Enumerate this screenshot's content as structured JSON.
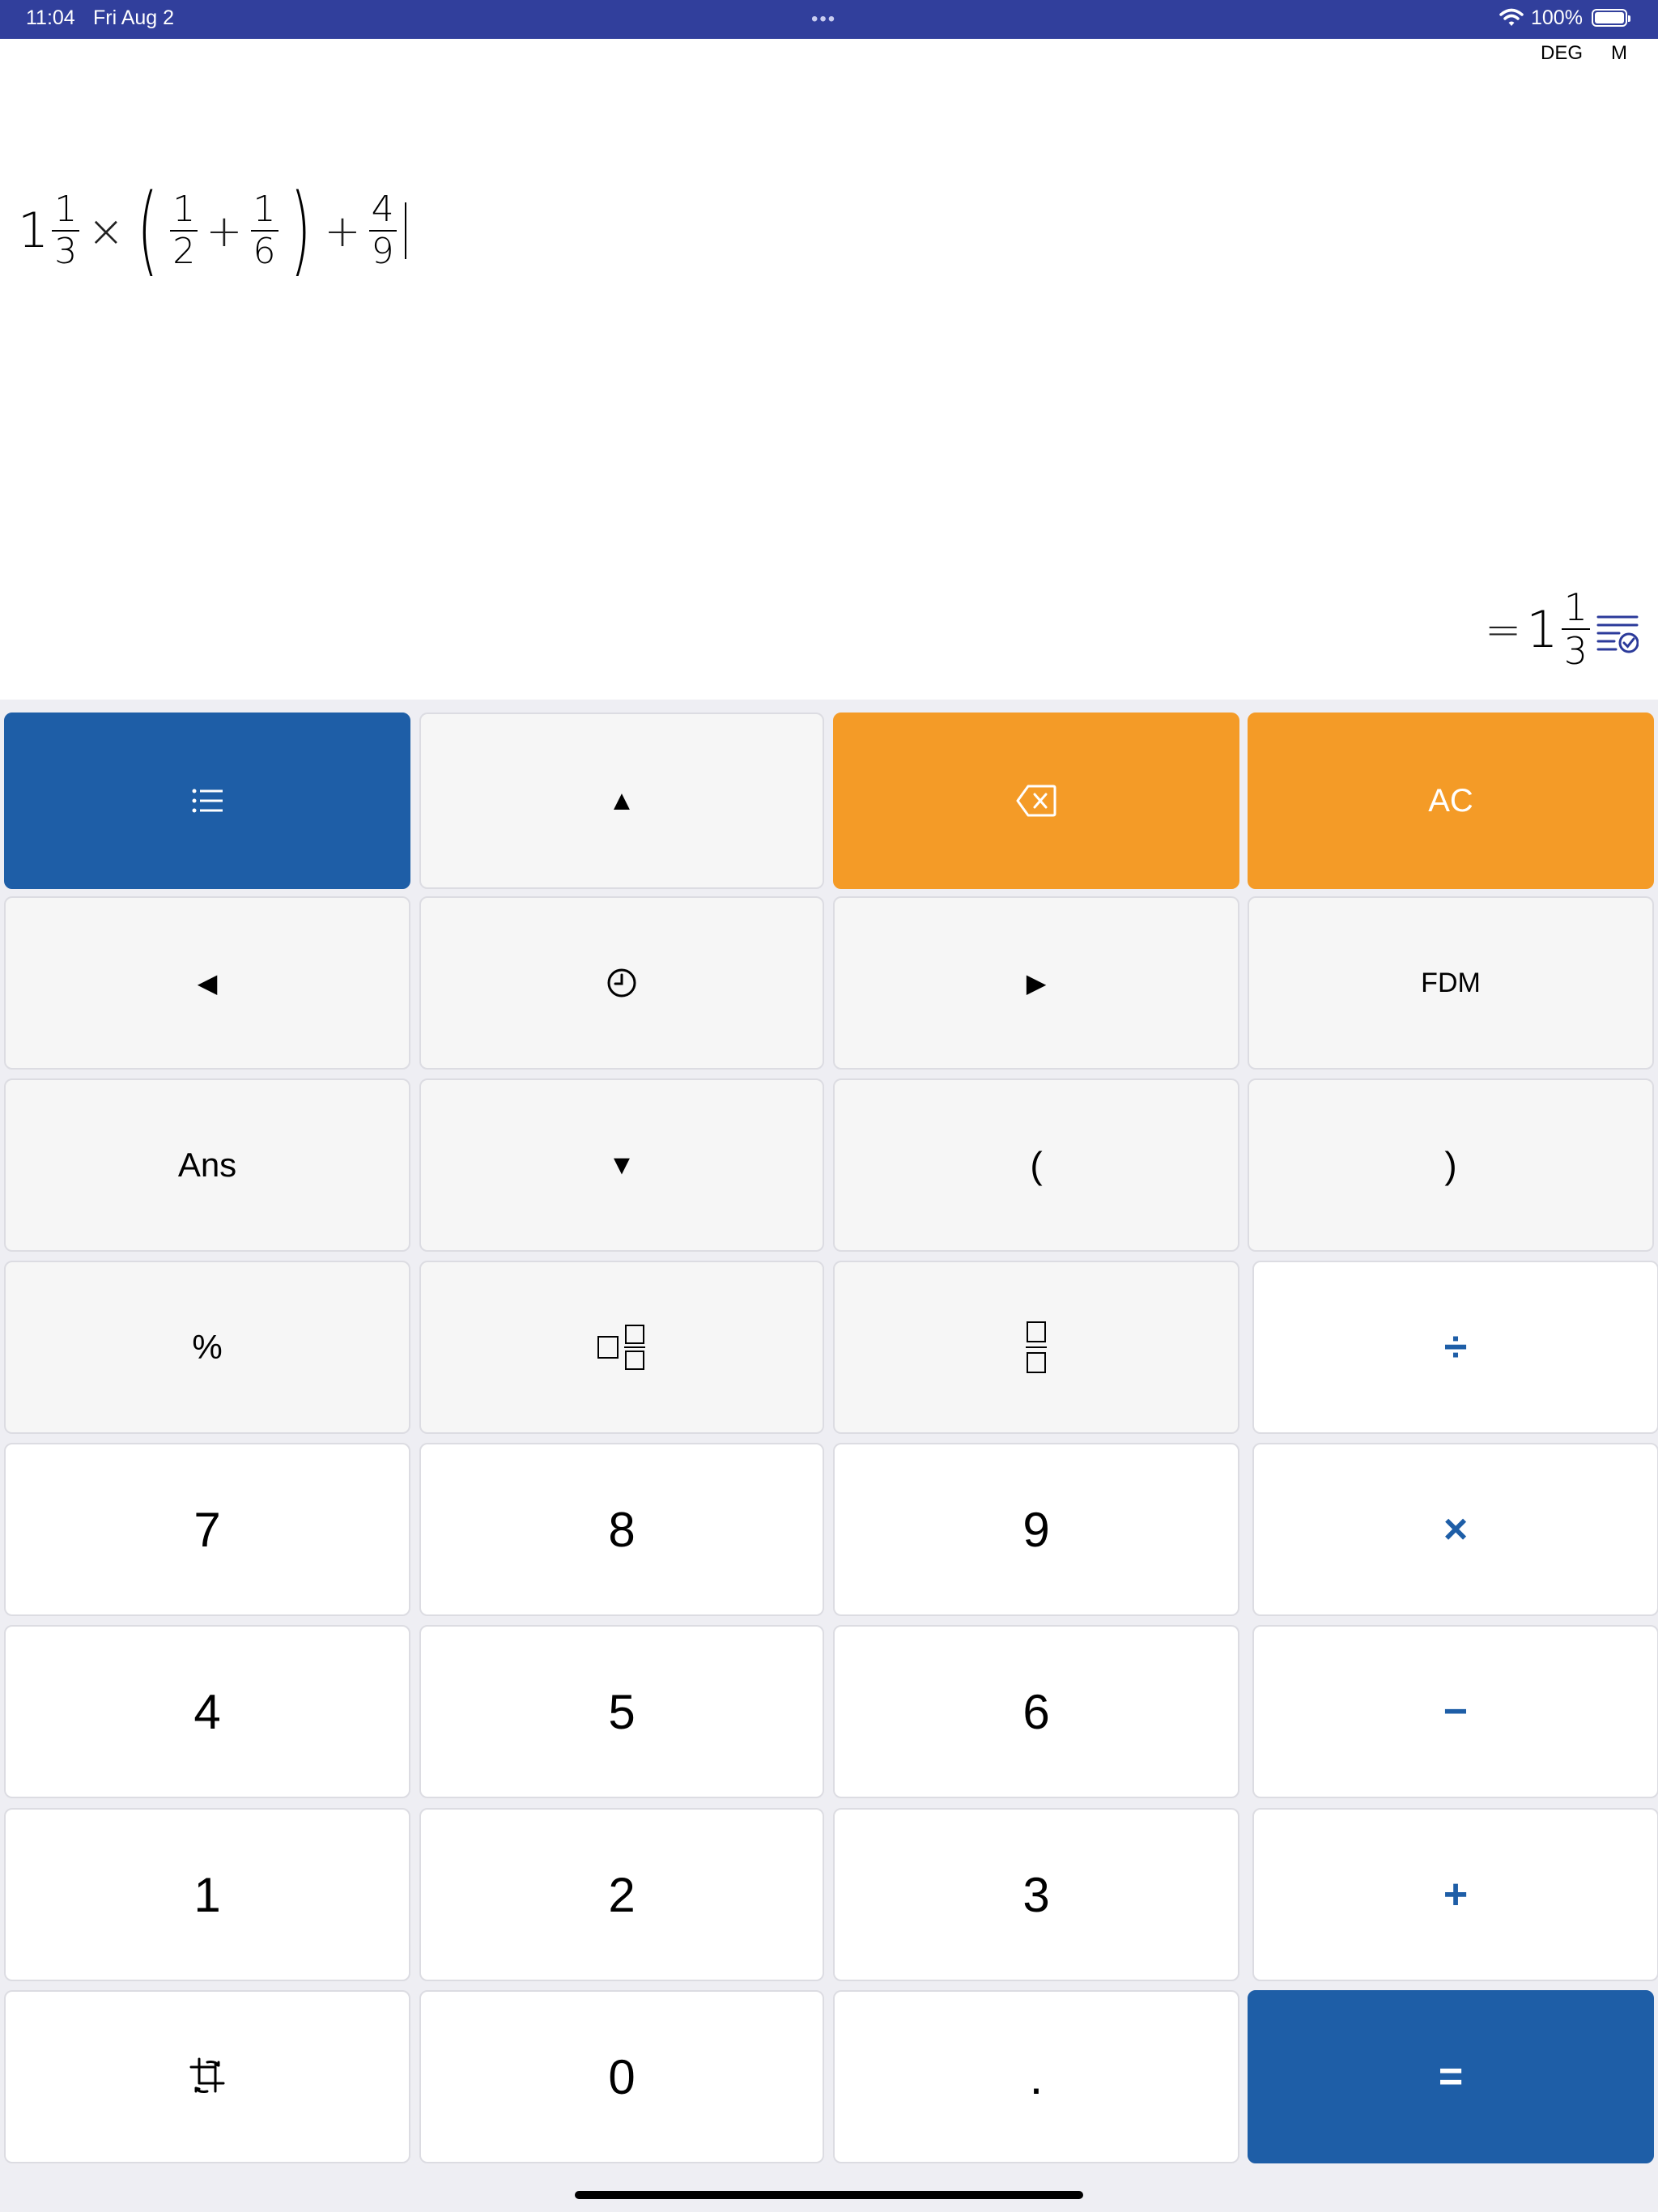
{
  "status_bar": {
    "time": "11:04",
    "date": "Fri Aug 2",
    "dots": "•••",
    "battery_pct": "100%",
    "bg_color": "#313f9c"
  },
  "modes": {
    "angle": "DEG",
    "memory": "M"
  },
  "expression": {
    "mixed_whole": "1",
    "mixed_num": "1",
    "mixed_den": "3",
    "times": "×",
    "open_paren": "(",
    "f1_num": "1",
    "f1_den": "2",
    "plus1": "+",
    "f2_num": "1",
    "f2_den": "6",
    "close_paren": ")",
    "plus2": "+",
    "f3_num": "4",
    "f3_den": "9"
  },
  "result": {
    "equals": "=",
    "whole": "1",
    "num": "1",
    "den": "3",
    "icon": "history-check-icon"
  },
  "colors": {
    "accent_blue": "#1e5ea7",
    "accent_orange": "#f49b27"
  },
  "keys": {
    "menu": "list-icon",
    "up": "▲",
    "backspace": "backspace-icon",
    "ac": "AC",
    "left": "◀",
    "history": "clock-icon",
    "right": "▶",
    "fdm": "FDM",
    "ans": "Ans",
    "down": "▼",
    "lparen": "(",
    "rparen": ")",
    "percent": "%",
    "mixed_fraction": "mixed-fraction-icon",
    "fraction": "fraction-icon",
    "divide": "÷",
    "seven": "7",
    "eight": "8",
    "nine": "9",
    "multiply": "×",
    "four": "4",
    "five": "5",
    "six": "6",
    "minus": "−",
    "one": "1",
    "two": "2",
    "three": "3",
    "plus": "+",
    "crop": "crop-rotate-icon",
    "zero": "0",
    "dot": ".",
    "equals": "="
  }
}
